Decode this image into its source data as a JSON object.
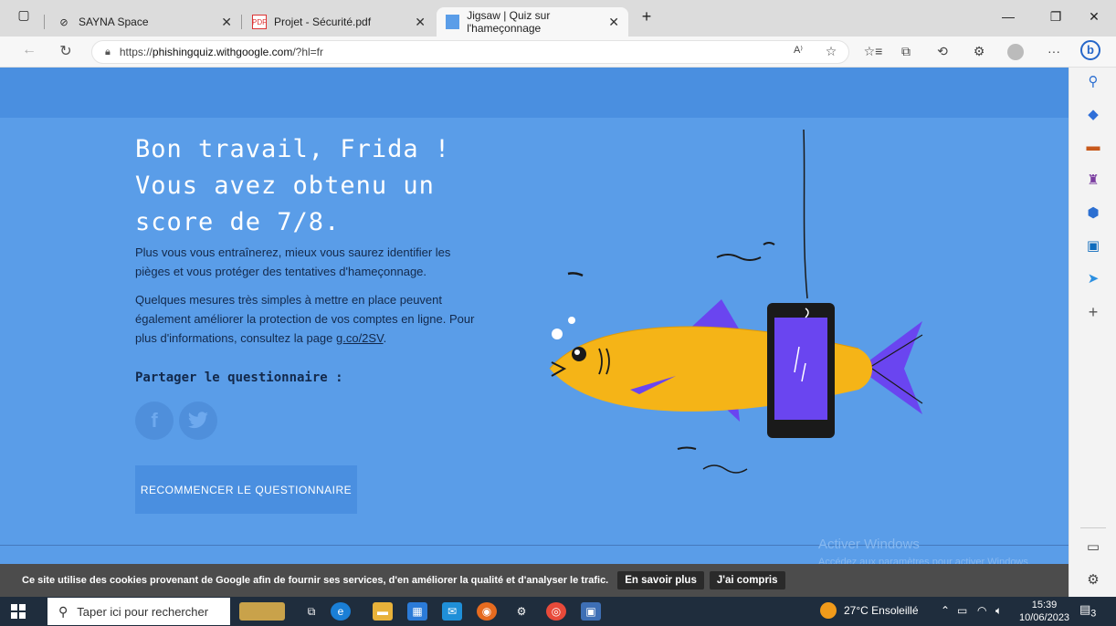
{
  "browser": {
    "tabs": [
      {
        "label": "SAYNA Space",
        "icon": "sayna-icon"
      },
      {
        "label": "Projet - Sécurité.pdf",
        "icon": "pdf-icon"
      },
      {
        "label": "Jigsaw | Quiz sur l'hameçonnage",
        "icon": "jigsaw-icon",
        "active": true
      }
    ],
    "url_prefix": "https://",
    "url_host": "phishingquiz.withgoogle.com",
    "url_path": "/?hl=fr"
  },
  "page": {
    "headline": "Bon travail, Frida ! Vous avez obtenu un score de 7/8.",
    "para1": "Plus vous vous entraînerez, mieux vous saurez identifier les pièges et vous protéger des tentatives d'hameçonnage.",
    "para2": "Quelques mesures très simples à mettre en place peuvent également améliorer la protection de vos comptes en ligne. Pour plus d'informations, consultez la page ",
    "para2_link": "g.co/2SV",
    "para2_end": ".",
    "share_title": "Partager le questionnaire :",
    "facebook_glyph": "f",
    "twitter_glyph": "t",
    "restart_label": "RECOMMENCER LE QUESTIONNAIRE",
    "watermark_title": "Activer Windows",
    "watermark_sub": "Accédez aux paramètres pour activer Windows."
  },
  "cookie": {
    "text": "Ce site utilise des cookies provenant de Google afin de fournir ses services, d'en améliorer la qualité et d'analyser le trafic.",
    "learn_more": "En savoir plus",
    "accept": "J'ai compris"
  },
  "taskbar": {
    "search_placeholder": "Taper ici pour rechercher",
    "weather": "27°C  Ensoleillé",
    "time": "15:39",
    "date": "10/06/2023",
    "notifications": "3"
  },
  "colors": {
    "page_bg": "#5a9de8",
    "header_bg": "#4a8fe0",
    "fish": "#f5b417",
    "phone": "#6a45f0"
  }
}
